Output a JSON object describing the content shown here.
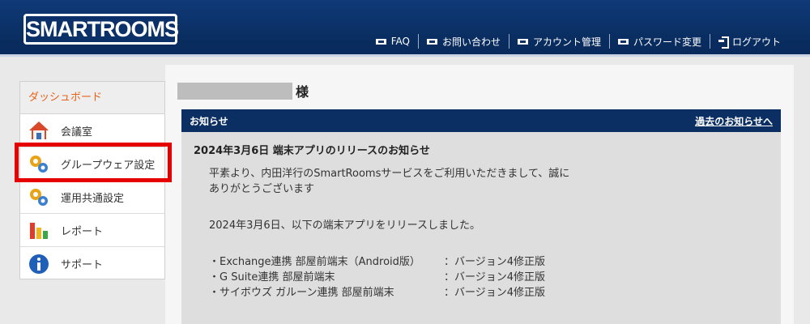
{
  "header": {
    "logo": "SMARTROOMS",
    "nav": [
      {
        "label": "FAQ",
        "icon": "card-icon"
      },
      {
        "label": "お問い合わせ",
        "icon": "card-icon"
      },
      {
        "label": "アカウント管理",
        "icon": "card-icon"
      },
      {
        "label": "パスワード変更",
        "icon": "card-icon"
      },
      {
        "label": "ログアウト",
        "icon": "logout-icon"
      }
    ]
  },
  "sidebar": {
    "title": "ダッシュボード",
    "items": [
      {
        "label": "会議室",
        "icon": "house-icon"
      },
      {
        "label": "グループウェア設定",
        "icon": "gears-icon"
      },
      {
        "label": "運用共通設定",
        "icon": "gears-icon"
      },
      {
        "label": "レポート",
        "icon": "bar-chart-icon"
      },
      {
        "label": "サポート",
        "icon": "info-icon"
      }
    ]
  },
  "user": {
    "suffix": "様"
  },
  "notice": {
    "header": "お知らせ",
    "past_link": "過去のお知らせへ",
    "subject": "2024年3月6日 端末アプリのリリースのお知らせ",
    "intro_line1": "平素より、内田洋行のSmartRoomsサービスをご利用いただきまして、誠に",
    "intro_line2": "ありがとうございます",
    "release_line": "2024年3月6日、以下の端末アプリをリリースしました。",
    "releases": [
      {
        "app": "・Exchange連携 部屋前端末（Android版）",
        "version": "：バージョン4修正版"
      },
      {
        "app": "・G Suite連携 部屋前端末",
        "version": "：バージョン4修正版"
      },
      {
        "app": "・サイボウズ ガルーン連携 部屋前端末",
        "version": "：バージョン4修正版"
      }
    ]
  },
  "colors": {
    "header": "#0b3168",
    "accent": "#e8631a",
    "highlight": "#e60000"
  }
}
